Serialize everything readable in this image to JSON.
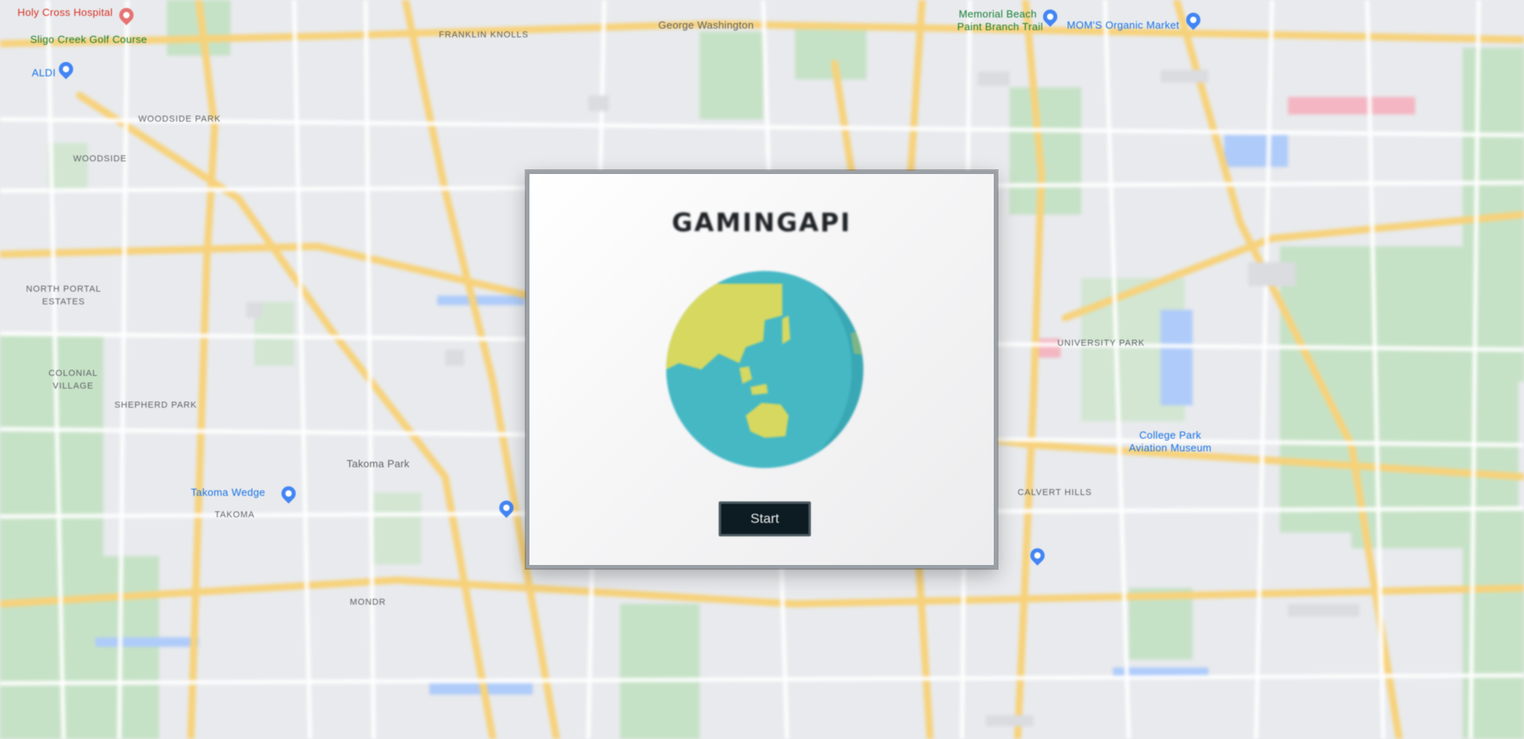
{
  "map": {
    "labels": [
      {
        "key": "holy_cross",
        "text": "Holy Cross Hospital",
        "style": "red"
      },
      {
        "key": "sligo",
        "text": "Sligo Creek Golf Course",
        "style": "green"
      },
      {
        "key": "aldi",
        "text": "ALDI",
        "style": "blue"
      },
      {
        "key": "woodside_park",
        "text": "WOODSIDE PARK",
        "style": "small-caps"
      },
      {
        "key": "woodside",
        "text": "WOODSIDE",
        "style": "small-caps"
      },
      {
        "key": "north_portal",
        "text": "NORTH PORTAL ESTATES",
        "style": "small-caps"
      },
      {
        "key": "colonial_village",
        "text": "COLONIAL VILLAGE",
        "style": "small-caps"
      },
      {
        "key": "shepherd_park",
        "text": "SHEPHERD PARK",
        "style": "small-caps"
      },
      {
        "key": "takoma_park",
        "text": "Takoma Park",
        "style": "plain"
      },
      {
        "key": "takoma",
        "text": "TAKOMA",
        "style": "small-caps"
      },
      {
        "key": "takoma_wedge",
        "text": "Takoma Wedge",
        "style": "blue"
      },
      {
        "key": "gw_hospital",
        "text": "George Washington",
        "style": "plain"
      },
      {
        "key": "memorial_beach",
        "text": "Memorial Beach",
        "style": "green"
      },
      {
        "key": "paint_branch",
        "text": "Paint Branch Trail",
        "style": "green"
      },
      {
        "key": "moms",
        "text": "MOM'S Organic Market",
        "style": "blue"
      },
      {
        "key": "university_park",
        "text": "UNIVERSITY PARK",
        "style": "small-caps"
      },
      {
        "key": "college_park",
        "text": "College Park Aviation Museum",
        "style": "blue"
      },
      {
        "key": "calvert_hills",
        "text": "CALVERT HILLS",
        "style": "small-caps"
      },
      {
        "key": "mondr",
        "text": "MONDR",
        "style": "small-caps"
      },
      {
        "key": "franklin",
        "text": "FRANKLIN KNOLLS",
        "style": "small-caps"
      }
    ]
  },
  "dialog": {
    "title": "GAMINGAPI",
    "start_label": "Start"
  },
  "colors": {
    "ocean": "#45b8c4",
    "land": "#d7d860",
    "button_bg": "#0d1c22"
  },
  "icons": {
    "globe": "globe-icon"
  }
}
